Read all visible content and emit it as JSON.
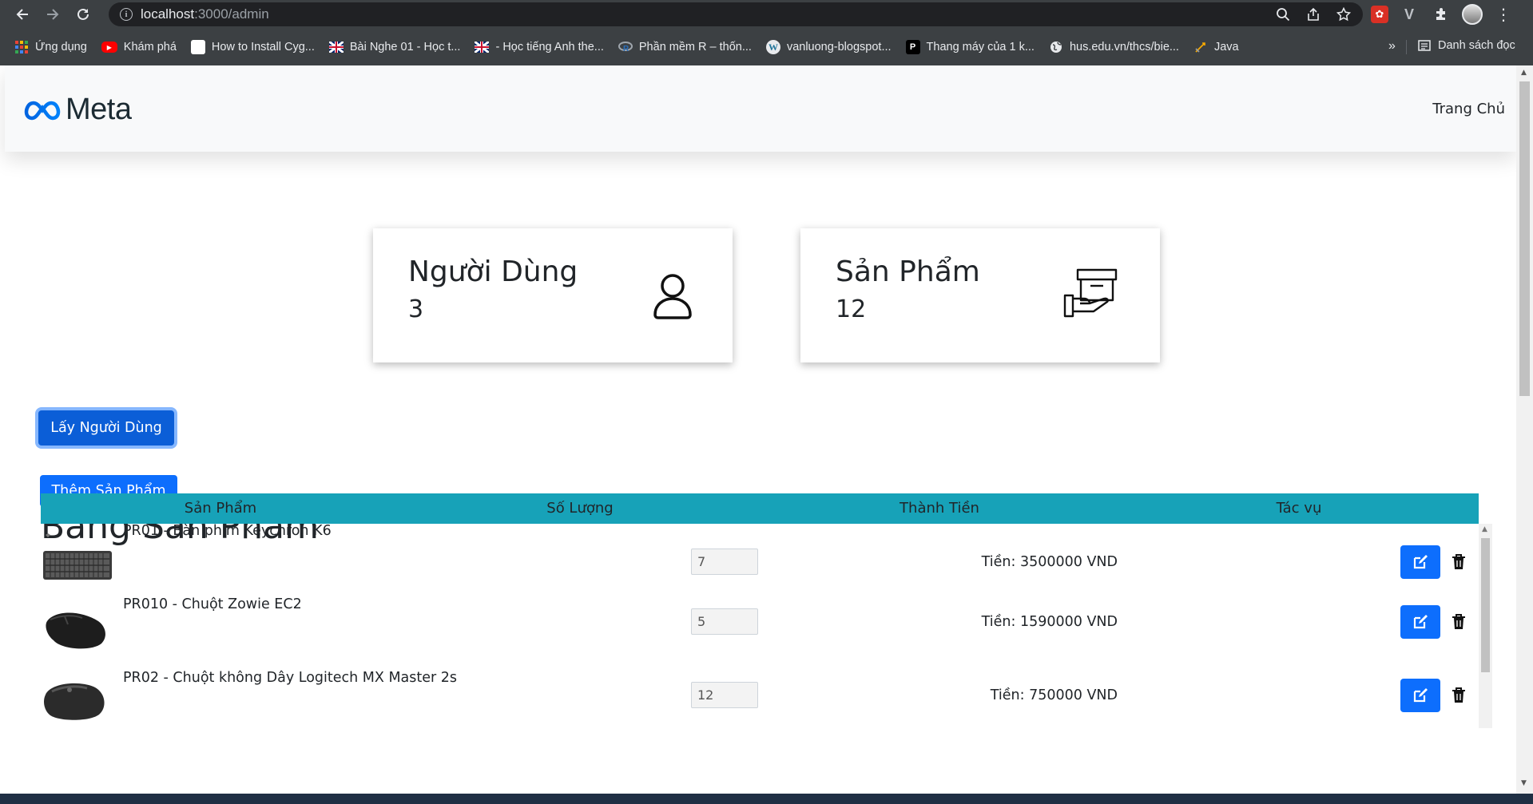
{
  "browser": {
    "url_host": "localhost",
    "url_path": ":3000/admin",
    "bookmarks": [
      {
        "label": "Ứng dụng",
        "icon": "apps-grid-icon",
        "color": "#ea4335"
      },
      {
        "label": "Khám phá",
        "icon": "youtube-icon",
        "color": "#ff0000"
      },
      {
        "label": "How to Install Cyg...",
        "icon": "page-icon",
        "color": "#ffffff"
      },
      {
        "label": "Bài Nghe 01 - Học t...",
        "icon": "uk-flag-icon",
        "color": "#c8102e"
      },
      {
        "label": "- Học tiếng Anh the...",
        "icon": "uk-flag-icon",
        "color": "#c8102e"
      },
      {
        "label": "Phần mềm R – thốn...",
        "icon": "r-logo-icon",
        "color": "#2a6ebb"
      },
      {
        "label": "vanluong-blogspot...",
        "icon": "wordpress-icon",
        "color": "#21759b"
      },
      {
        "label": "Thang máy của 1 k...",
        "icon": "pinterest-icon",
        "color": "#000000"
      },
      {
        "label": "hus.edu.vn/thcs/bie...",
        "icon": "globe-icon",
        "color": "#e8eaed"
      },
      {
        "label": "Java",
        "icon": "bookmark-folder-icon",
        "color": "#f9ab00"
      }
    ],
    "more_label": "»",
    "reading_list_label": "Danh sách đọc"
  },
  "navbar": {
    "brand": "Meta",
    "home_link": "Trang Chủ",
    "brand_color": "#0668E1"
  },
  "stats": {
    "users": {
      "title": "Người Dùng",
      "value": "3"
    },
    "products": {
      "title": "Sản Phẩm",
      "value": "12"
    }
  },
  "actions": {
    "get_users": "Lấy Người Dùng",
    "add_product": "Thêm Sản Phẩm"
  },
  "table": {
    "heading": "Bảng Sản Phẩm",
    "header_color": "#17a2b8",
    "columns": [
      "Sản Phẩm",
      "Số Lượng",
      "Thành Tiền",
      "Tác vụ"
    ],
    "rows": [
      {
        "name": "PR01 - Bàn phím Keychron K6",
        "qty": "7",
        "price": "Tiền: 3500000 VND",
        "image": "keyboard-image"
      },
      {
        "name": "PR010 - Chuột Zowie EC2",
        "qty": "5",
        "price": "Tiền: 1590000 VND",
        "image": "mouse-image"
      },
      {
        "name": "PR02  - Chuột không Dây Logitech MX Master 2s",
        "qty": "12",
        "price": "Tiền: 750000 VND",
        "image": "wireless-mouse-image"
      }
    ]
  }
}
